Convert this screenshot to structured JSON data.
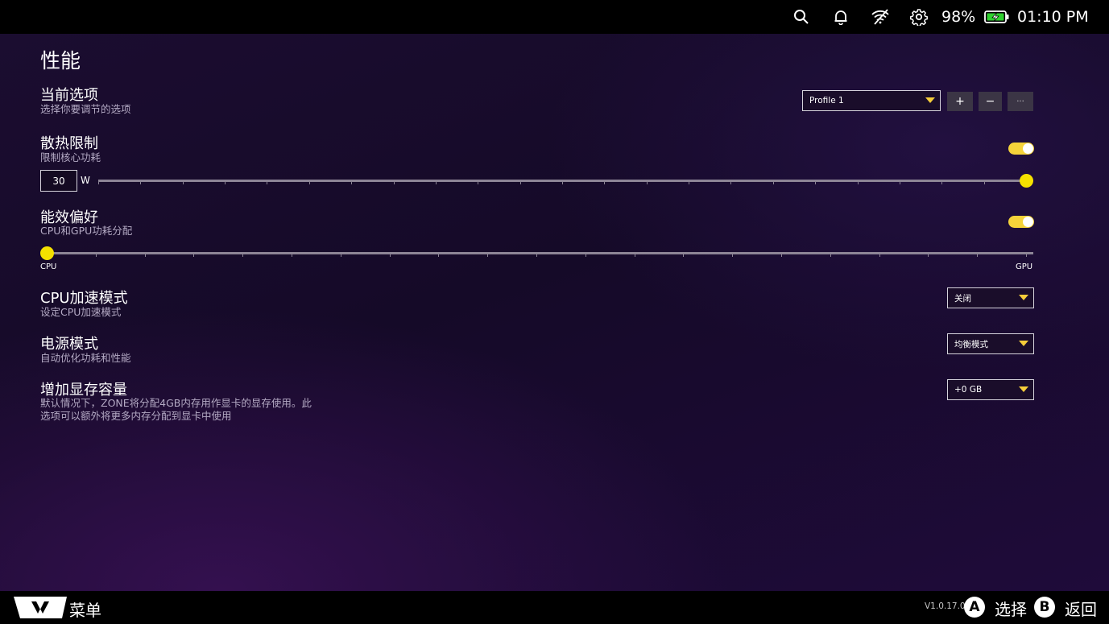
{
  "status_bar": {
    "battery_percent": "98%",
    "time": "01:10 PM",
    "icons": [
      "search-icon",
      "bell-icon",
      "wifi-off-icon",
      "gear-icon",
      "battery-charging-icon"
    ],
    "battery_color": "#2fd12f"
  },
  "page": {
    "title": "性能"
  },
  "current_profile": {
    "title": "当前选项",
    "subtitle": "选择你要调节的选项",
    "selected": "Profile 1",
    "add_label": "+",
    "remove_label": "−",
    "more_label": "···"
  },
  "thermal_limit": {
    "title": "散热限制",
    "subtitle": "限制核心功耗",
    "enabled": true,
    "value": "30",
    "unit": "W",
    "slider_level": 1.0
  },
  "efficiency": {
    "title": "能效偏好",
    "subtitle": "CPU和GPU功耗分配",
    "enabled": true,
    "min_label": "CPU",
    "max_label": "GPU",
    "slider_level": 0.0
  },
  "cpu_boost": {
    "title": "CPU加速模式",
    "subtitle": "设定CPU加速模式",
    "selected": "关闭"
  },
  "power_mode": {
    "title": "电源模式",
    "subtitle": "自动优化功耗和性能",
    "selected": "均衡模式"
  },
  "vram": {
    "title": "增加显存容量",
    "subtitle_line1": "默认情况下，ZONE将分配4GB内存用作显卡的显存使用。此",
    "subtitle_line2": "选项可以额外将更多内存分配到显卡中使用",
    "selected": "+0 GB"
  },
  "bottom_bar": {
    "menu_label": "菜单",
    "version": "V1.0.17.0",
    "a_key": "A",
    "a_label": "选择",
    "b_key": "B",
    "b_label": "返回"
  },
  "colors": {
    "accent_yellow": "#f5e100",
    "toggle_yellow": "#f5d33a",
    "background": "#1a0c2e"
  }
}
